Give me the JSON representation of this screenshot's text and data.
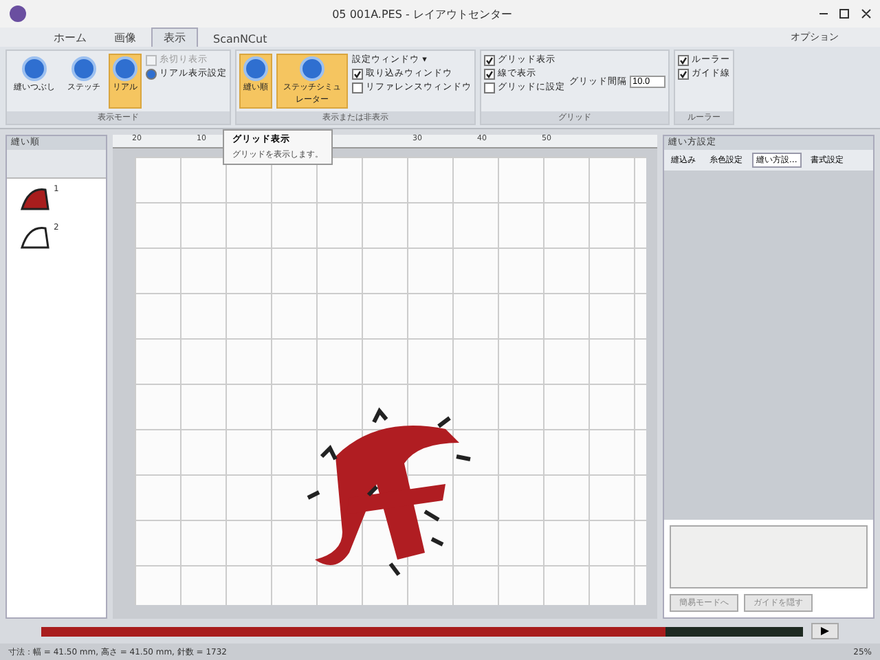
{
  "window": {
    "title": "05 001A.PES - レイアウトセンター",
    "options": "オプション"
  },
  "tabs": [
    {
      "label": "ホーム",
      "selected": false
    },
    {
      "label": "画像",
      "selected": false
    },
    {
      "label": "表示",
      "selected": true
    },
    {
      "label": "ScanNCut",
      "selected": false
    }
  ],
  "ribbon": {
    "groups": [
      {
        "title": "表示モード",
        "buttons": [
          {
            "label": "縫いつぶし",
            "selected": false
          },
          {
            "label": "ステッチ",
            "selected": false
          },
          {
            "label": "リアル",
            "selected": true
          }
        ],
        "options": [
          {
            "kind": "checkbox",
            "label": "糸切り表示",
            "checked": false,
            "disabled": true
          },
          {
            "kind": "radio",
            "label": "リアル表示設定",
            "checked": true,
            "disabled": false
          }
        ]
      },
      {
        "title": "表示または非表示",
        "buttons": [
          {
            "label": "縫い順",
            "selected": true
          },
          {
            "label": "ステッチシミュレーター",
            "selected": true
          }
        ],
        "options": [
          {
            "kind": "menu",
            "label": "設定ウィンドウ ▾"
          },
          {
            "kind": "checkbox",
            "label": "取り込みウィンドウ",
            "checked": true,
            "disabled": false
          },
          {
            "kind": "checkbox",
            "label": "リファレンスウィンドウ",
            "checked": false,
            "disabled": false
          }
        ]
      },
      {
        "title": "グリッド",
        "options": [
          {
            "kind": "checkbox",
            "label": "グリッド表示",
            "checked": true,
            "disabled": false
          },
          {
            "kind": "checkbox",
            "label": "線で表示",
            "checked": true,
            "disabled": false
          },
          {
            "kind": "checkbox",
            "label": "グリッドに設定",
            "checked": false,
            "disabled": false
          }
        ],
        "spacing": {
          "label": "グリッド間隔",
          "value": "10.0"
        }
      },
      {
        "title": "ルーラー",
        "options": [
          {
            "kind": "checkbox",
            "label": "ルーラー",
            "checked": true,
            "disabled": false
          },
          {
            "kind": "checkbox",
            "label": "ガイド線",
            "checked": true,
            "disabled": false
          }
        ]
      }
    ]
  },
  "tooltip": {
    "title": "グリッド表示",
    "text": "グリッドを表示します。"
  },
  "sewing_order": {
    "title": "縫い順",
    "items": [
      {
        "number": "1"
      },
      {
        "number": "2"
      }
    ]
  },
  "ruler": {
    "ticks": [
      "20",
      "10",
      "30",
      "40",
      "50"
    ]
  },
  "sewing_settings": {
    "title": "縫い方設定",
    "tabs": [
      {
        "label": "縫込み",
        "selected": false
      },
      {
        "label": "糸色設定",
        "selected": false
      },
      {
        "label": "縫い方設...",
        "selected": true
      },
      {
        "label": "書式設定",
        "selected": false
      }
    ],
    "buttons": [
      "簡易モードへ",
      "ガイドを隠す"
    ]
  },
  "simulator": {
    "level": 0.82
  },
  "status_bar": {
    "text": "寸法：幅 = 41.50 mm, 高さ = 41.50 mm, 針数 = 1732",
    "zoom": "25%"
  }
}
